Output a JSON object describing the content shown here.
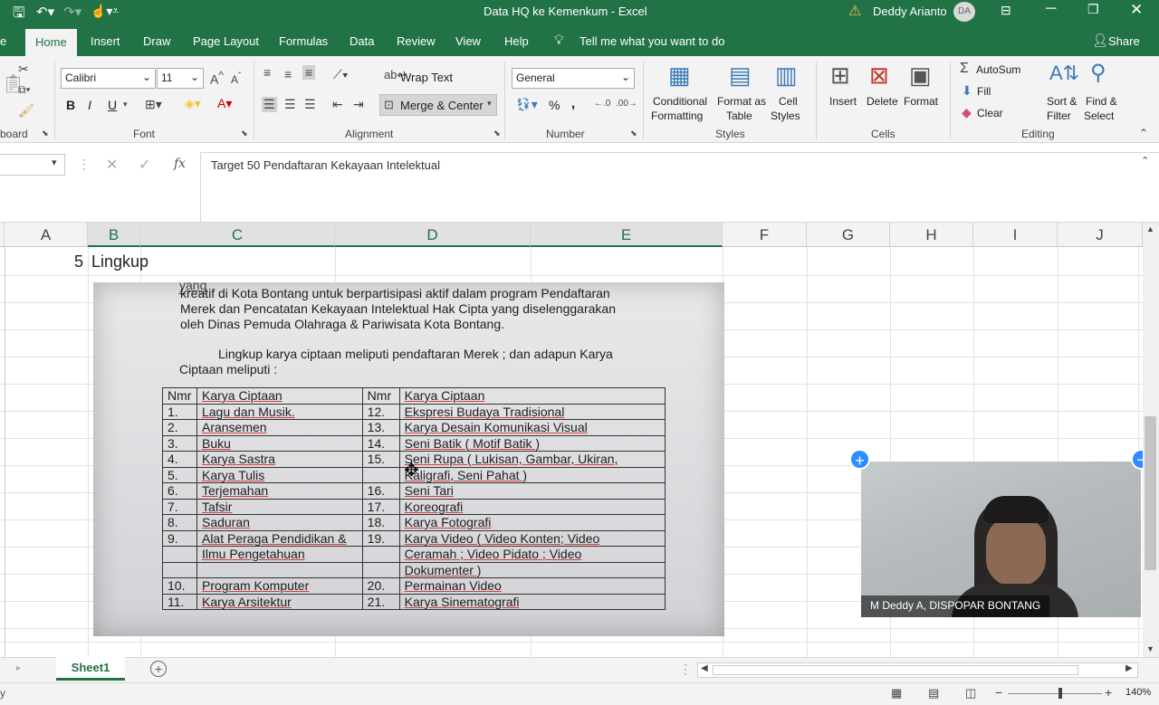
{
  "window": {
    "title": "Data HQ ke Kemenkum  -  Excel",
    "user_name": "Deddy Arianto",
    "user_initials": "DA"
  },
  "tabs": [
    "Home",
    "Insert",
    "Draw",
    "Page Layout",
    "Formulas",
    "Data",
    "Review",
    "View",
    "Help"
  ],
  "tell_me": "Tell me what you want to do",
  "share": "Share",
  "ribbon": {
    "clipboard_label": "board",
    "font": {
      "name": "Calibri",
      "size": "11",
      "label": "Font",
      "bold": "B",
      "italic": "I",
      "underline": "U"
    },
    "alignment": {
      "wrap": "Wrap Text",
      "merge": "Merge & Center",
      "label": "Alignment"
    },
    "number": {
      "format": "General",
      "percent": "%",
      "comma": ",",
      "label": "Number"
    },
    "styles": {
      "cond1": "Conditional",
      "cond2": "Formatting",
      "fmt1": "Format as",
      "fmt2": "Table",
      "cell1": "Cell",
      "cell2": "Styles",
      "label": "Styles"
    },
    "cells": {
      "insert": "Insert",
      "delete": "Delete",
      "format": "Format",
      "label": "Cells"
    },
    "editing": {
      "autosum": "AutoSum",
      "fill": "Fill",
      "clear": "Clear",
      "sort1": "Sort &",
      "sort2": "Filter",
      "find1": "Find &",
      "find2": "Select",
      "label": "Editing"
    }
  },
  "formula_bar": {
    "fx": "fx",
    "content": "Target 50 Pendaftaran Kekayaan Intelektual"
  },
  "columns": [
    "A",
    "B",
    "C",
    "D",
    "E",
    "F",
    "G",
    "H",
    "I",
    "J"
  ],
  "row": {
    "number": "5",
    "b_value": "Lingkup"
  },
  "document_image": {
    "line1": "kreatif di Kota Bontang untuk berpartisipasi aktif dalam program Pendaftaran",
    "line2": "Merek dan Pencatatan Kekayaan Intelektual Hak Cipta yang diselenggarakan",
    "line3": "oleh Dinas Pemuda Olahraga & Pariwisata Kota Bontang.",
    "line4": "Lingkup  karya ciptaan meliputi pendaftaran Merek ; dan adapun Karya",
    "line5": "Ciptaan meliputi :",
    "table_rows": [
      [
        "Nmr",
        "Karya Ciptaan",
        "Nmr",
        "Karya Ciptaan"
      ],
      [
        "1.",
        "Lagu dan Musik.",
        "12.",
        "Ekspresi Budaya Tradisional"
      ],
      [
        "2.",
        "Aransemen",
        "13.",
        "Karya Desain Komunikasi Visual"
      ],
      [
        "3.",
        "Buku",
        "14.",
        "Seni Batik ( Motif Batik )"
      ],
      [
        "4.",
        "Karya Sastra",
        "15.",
        "Seni  Rupa  ( Lukisan,  Gambar,  Ukiran,"
      ],
      [
        "5.",
        "Karya Tulis",
        "",
        "Kaligrafi, Seni Pahat )"
      ],
      [
        "6.",
        "Terjemahan",
        "16.",
        "Seni Tari"
      ],
      [
        "7.",
        "Tafsir",
        "17.",
        "Koreografi"
      ],
      [
        "8.",
        "Saduran",
        "18.",
        "Karya Fotografi"
      ],
      [
        "9.",
        "Alat Peraga Pendidikan &",
        "19.",
        "Karya  Video  ( Video  Konten;  Video"
      ],
      [
        "",
        "Ilmu Pengetahuan",
        "",
        "Ceramah  ;  Video  Pidato  ;  Video"
      ],
      [
        "",
        "",
        "",
        "Dokumenter )"
      ],
      [
        "10.",
        "Program Komputer",
        "20.",
        "Permainan Video"
      ],
      [
        "11.",
        "Karya Arsitektur",
        "21.",
        "Karya Sinematografi"
      ]
    ]
  },
  "video_overlay": {
    "name": "M Deddy A, DISPOPAR BONTANG"
  },
  "sheet_tab": "Sheet1",
  "status": {
    "zoom": "140%",
    "left_char": "y"
  }
}
